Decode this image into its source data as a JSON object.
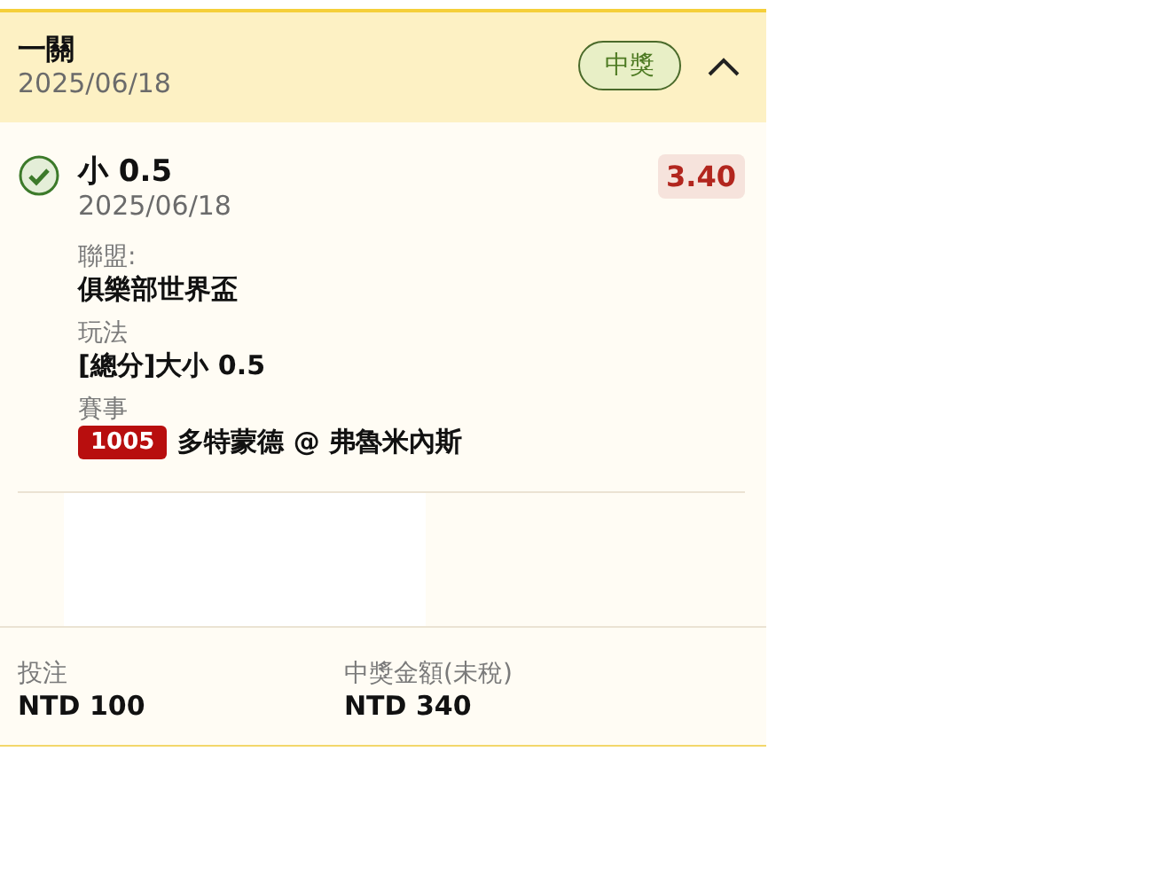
{
  "header": {
    "title": "一關",
    "date": "2025/06/18",
    "status": {
      "label": "中獎",
      "kind": "won"
    },
    "expanded": true
  },
  "selection": {
    "checked": true,
    "pick": "小 0.5",
    "date": "2025/06/18",
    "odds": "3.40",
    "details": [
      {
        "label": "聯盟:",
        "value": "俱樂部世界盃"
      },
      {
        "label": "玩法",
        "value": "[總分]大小 0.5"
      },
      {
        "label": "賽事",
        "code": "1005",
        "value": "多特蒙德 @ 弗魯米內斯"
      }
    ]
  },
  "footer": [
    {
      "label": "投注",
      "value": "NTD 100"
    },
    {
      "label": "中獎金額(未稅)",
      "value": "NTD 340"
    }
  ]
}
